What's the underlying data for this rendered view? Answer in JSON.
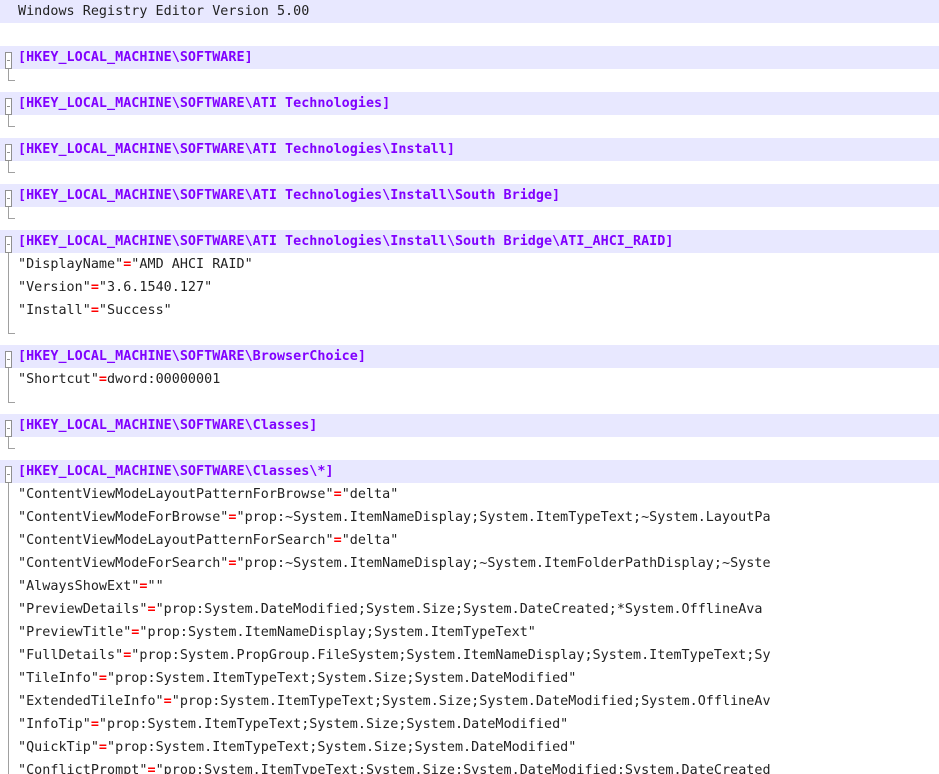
{
  "header": "Windows Registry Editor Version 5.00",
  "colors": {
    "section": "#8000ff",
    "equals": "#ff0000",
    "text": "#222222",
    "highlight": "#e8e8ff"
  },
  "lines": [
    {
      "kind": "header",
      "text": "Windows Registry Editor Version 5.00"
    },
    {
      "kind": "blank"
    },
    {
      "kind": "section",
      "text": "[HKEY_LOCAL_MACHINE\\SOFTWARE]",
      "fold": "end"
    },
    {
      "kind": "blank"
    },
    {
      "kind": "section",
      "text": "[HKEY_LOCAL_MACHINE\\SOFTWARE\\ATI Technologies]",
      "fold": "end"
    },
    {
      "kind": "blank"
    },
    {
      "kind": "section",
      "text": "[HKEY_LOCAL_MACHINE\\SOFTWARE\\ATI Technologies\\Install]",
      "fold": "end"
    },
    {
      "kind": "blank"
    },
    {
      "kind": "section",
      "text": "[HKEY_LOCAL_MACHINE\\SOFTWARE\\ATI Technologies\\Install\\South Bridge]",
      "fold": "end"
    },
    {
      "kind": "blank"
    },
    {
      "kind": "section",
      "text": "[HKEY_LOCAL_MACHINE\\SOFTWARE\\ATI Technologies\\Install\\South Bridge\\ATI_AHCI_RAID]",
      "fold": "start"
    },
    {
      "kind": "entry",
      "name": "\"DisplayName\"",
      "eq": "=",
      "value": "\"AMD AHCI RAID\"",
      "tree": "mid"
    },
    {
      "kind": "entry",
      "name": "\"Version\"",
      "eq": "=",
      "value": "\"3.6.1540.127\"",
      "tree": "mid"
    },
    {
      "kind": "entry",
      "name": "\"Install\"",
      "eq": "=",
      "value": "\"Success\"",
      "tree": "mid"
    },
    {
      "kind": "blank",
      "tree": "end"
    },
    {
      "kind": "section",
      "text": "[HKEY_LOCAL_MACHINE\\SOFTWARE\\BrowserChoice]",
      "fold": "start"
    },
    {
      "kind": "entry",
      "name": "\"Shortcut\"",
      "eq": "=",
      "value": "dword:00000001",
      "tree": "mid"
    },
    {
      "kind": "blank",
      "tree": "end"
    },
    {
      "kind": "section",
      "text": "[HKEY_LOCAL_MACHINE\\SOFTWARE\\Classes]",
      "fold": "end"
    },
    {
      "kind": "blank"
    },
    {
      "kind": "section",
      "text": "[HKEY_LOCAL_MACHINE\\SOFTWARE\\Classes\\*]",
      "fold": "start"
    },
    {
      "kind": "entry",
      "name": "\"ContentViewModeLayoutPatternForBrowse\"",
      "eq": "=",
      "value": "\"delta\"",
      "tree": "mid"
    },
    {
      "kind": "entry",
      "name": "\"ContentViewModeForBrowse\"",
      "eq": "=",
      "value": "\"prop:~System.ItemNameDisplay;System.ItemTypeText;~System.LayoutPa",
      "tree": "mid"
    },
    {
      "kind": "entry",
      "name": "\"ContentViewModeLayoutPatternForSearch\"",
      "eq": "=",
      "value": "\"delta\"",
      "tree": "mid"
    },
    {
      "kind": "entry",
      "name": "\"ContentViewModeForSearch\"",
      "eq": "=",
      "value": "\"prop:~System.ItemNameDisplay;~System.ItemFolderPathDisplay;~Syste",
      "tree": "mid"
    },
    {
      "kind": "entry",
      "name": "\"AlwaysShowExt\"",
      "eq": "=",
      "value": "\"\"",
      "tree": "mid"
    },
    {
      "kind": "entry",
      "name": "\"PreviewDetails\"",
      "eq": "=",
      "value": "\"prop:System.DateModified;System.Size;System.DateCreated;*System.OfflineAva",
      "tree": "mid"
    },
    {
      "kind": "entry",
      "name": "\"PreviewTitle\"",
      "eq": "=",
      "value": "\"prop:System.ItemNameDisplay;System.ItemTypeText\"",
      "tree": "mid"
    },
    {
      "kind": "entry",
      "name": "\"FullDetails\"",
      "eq": "=",
      "value": "\"prop:System.PropGroup.FileSystem;System.ItemNameDisplay;System.ItemTypeText;Sy",
      "tree": "mid"
    },
    {
      "kind": "entry",
      "name": "\"TileInfo\"",
      "eq": "=",
      "value": "\"prop:System.ItemTypeText;System.Size;System.DateModified\"",
      "tree": "mid"
    },
    {
      "kind": "entry",
      "name": "\"ExtendedTileInfo\"",
      "eq": "=",
      "value": "\"prop:System.ItemTypeText;System.Size;System.DateModified;System.OfflineAv",
      "tree": "mid"
    },
    {
      "kind": "entry",
      "name": "\"InfoTip\"",
      "eq": "=",
      "value": "\"prop:System.ItemTypeText;System.Size;System.DateModified\"",
      "tree": "mid"
    },
    {
      "kind": "entry",
      "name": "\"QuickTip\"",
      "eq": "=",
      "value": "\"prop:System.ItemTypeText;System.Size;System.DateModified\"",
      "tree": "mid"
    },
    {
      "kind": "entry",
      "name": "\"ConflictPrompt\"",
      "eq": "=",
      "value": "\"prop:System.ItemTypeText;System.Size;System.DateModified;System.DateCreated",
      "tree": "mid"
    }
  ]
}
